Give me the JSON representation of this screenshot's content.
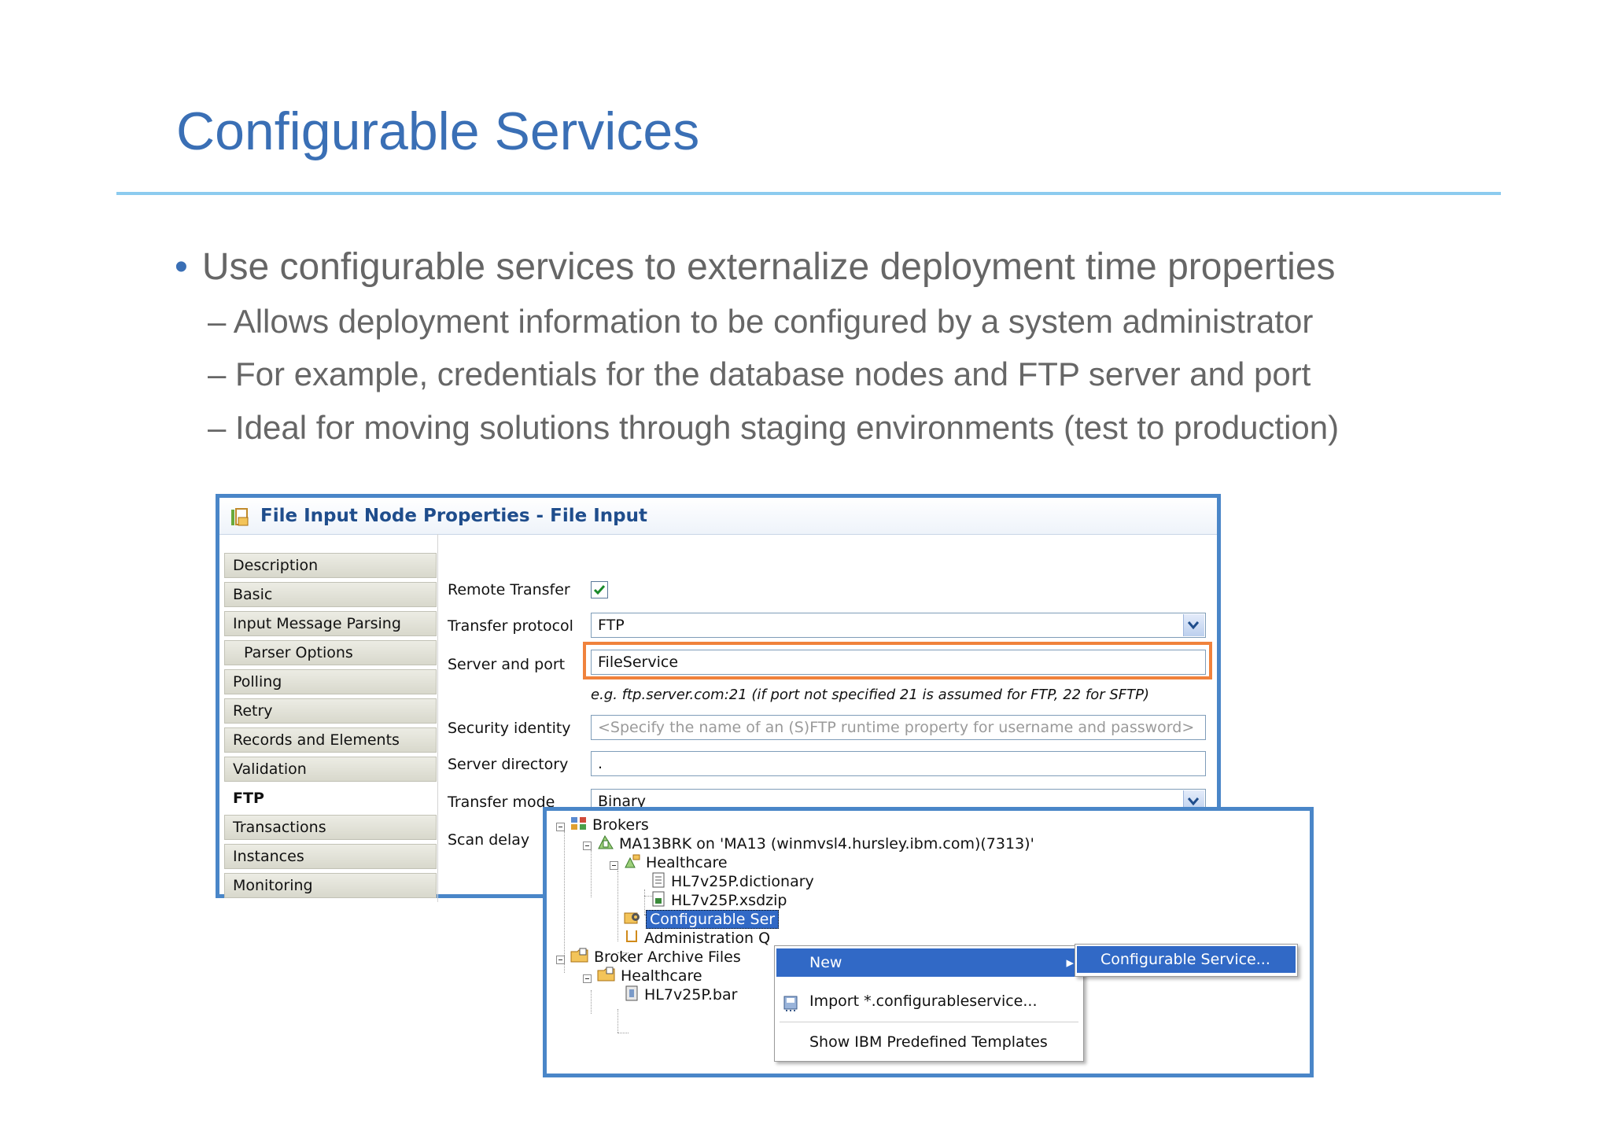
{
  "slide": {
    "title": "Configurable Services",
    "bullet": "Use configurable services to externalize deployment time properties",
    "subbullets": [
      "– Allows deployment information to be configured by a system administrator",
      "– For example, credentials for the database nodes and FTP server and port",
      "– Ideal for moving solutions through staging environments (test to production)"
    ]
  },
  "properties": {
    "title": "File Input Node Properties - File Input",
    "nav": [
      "Description",
      "Basic",
      "Input Message Parsing",
      "Parser Options",
      "Polling",
      "Retry",
      "Records and Elements",
      "Validation",
      "FTP",
      "Transactions",
      "Instances",
      "Monitoring"
    ],
    "active_nav": "FTP",
    "fields": {
      "remote_transfer_label": "Remote Transfer",
      "remote_transfer_checked": true,
      "transfer_protocol_label": "Transfer protocol",
      "transfer_protocol_value": "FTP",
      "server_port_label": "Server and port",
      "server_port_value": "FileService",
      "server_port_hint": "e.g. ftp.server.com:21 (if port not specified 21 is assumed for FTP, 22 for SFTP)",
      "security_identity_label": "Security identity",
      "security_identity_placeholder": "<Specify the name of an (S)FTP runtime property for username and password>",
      "server_directory_label": "Server directory",
      "server_directory_value": ".",
      "transfer_mode_label": "Transfer mode",
      "transfer_mode_value": "Binary",
      "scan_delay_label": "Scan delay"
    }
  },
  "tree": {
    "brokers": "Brokers",
    "broker": "MA13BRK on 'MA13 (winmvsl4.hursley.ibm.com)(7313)'",
    "healthcare": "Healthcare",
    "dictionary": "HL7v25P.dictionary",
    "xsdzip": "HL7v25P.xsdzip",
    "configurable_services": "Configurable Ser",
    "administration": "Administration Q",
    "broker_archive_files": "Broker Archive Files",
    "archive_healthcare": "Healthcare",
    "bar": "HL7v25P.bar"
  },
  "context_menu": {
    "new": "New",
    "import": "Import *.configurableservice...",
    "show_templates": "Show IBM Predefined Templates",
    "submenu_item": "Configurable Service..."
  },
  "colors": {
    "title_blue": "#3a6fb5",
    "rule": "#8ccbef",
    "frame_blue": "#4a86c8",
    "highlight_orange": "#f0823c",
    "selection_blue": "#3169c6"
  }
}
